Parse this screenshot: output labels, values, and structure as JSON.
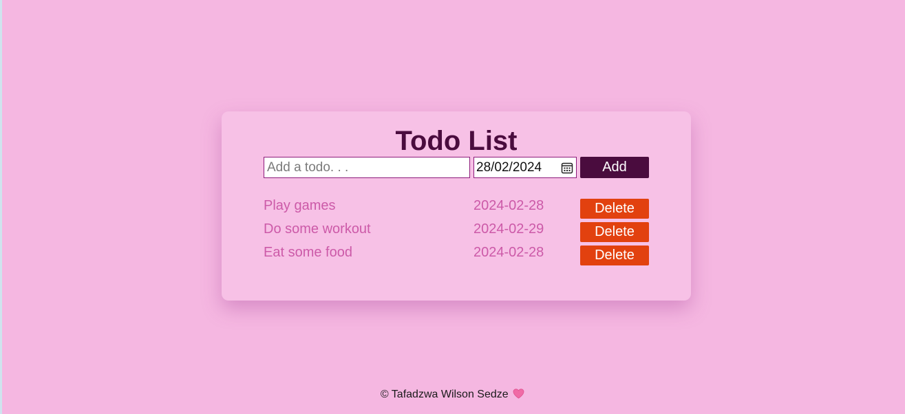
{
  "app": {
    "title": "Todo List"
  },
  "form": {
    "todo_placeholder": "Add a todo. . .",
    "todo_value": "",
    "date_value": "28/02/2024",
    "add_label": "Add"
  },
  "todos": [
    {
      "text": "Play games",
      "date": "2024-02-28",
      "delete_label": "Delete"
    },
    {
      "text": "Do some workout",
      "date": "2024-02-29",
      "delete_label": "Delete"
    },
    {
      "text": "Eat some food",
      "date": "2024-02-28",
      "delete_label": "Delete"
    }
  ],
  "footer": {
    "text": "© Tafadzwa Wilson Sedze",
    "icon": "heart-icon"
  },
  "colors": {
    "background": "#f5b7e1",
    "card": "#f7c1e6",
    "accent": "#4a0c3e",
    "delete": "#e2410f",
    "todo_text": "#cc5aa8"
  }
}
